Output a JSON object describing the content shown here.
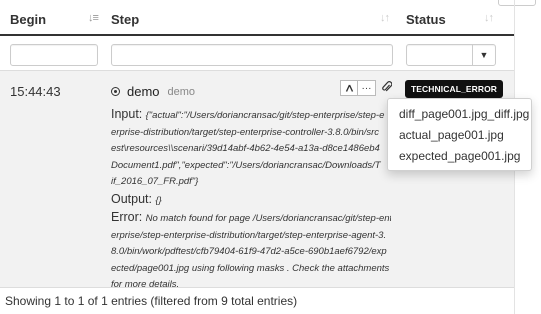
{
  "table": {
    "columns": [
      {
        "label": "Begin",
        "sort_icon": "sort-amount-down-icon"
      },
      {
        "label": "Step",
        "sort_icon": "sort-icon"
      },
      {
        "label": "Status",
        "sort_icon": "sort-icon"
      }
    ],
    "filters": {
      "begin_value": "",
      "step_value": "",
      "status_selected": ""
    },
    "rows": [
      {
        "begin": "15:44:43",
        "step_name": "demo",
        "step_sub": "demo",
        "status": "TECHNICAL_ERROR",
        "input_label": "Input:",
        "input_lines": [
          "{\"actual\":\"/Users/doriancransac/git/step-enterprise/step-e",
          "erprise-distribution/target/step-enterprise-controller-3.8.0/bin/src",
          "est\\resources\\\\scenari/39d14abf-4b62-4e54-a13a-d8ce1486eb4",
          "Document1.pdf\",\"expected\":\"/Users/doriancransac/Downloads/T",
          "if_2016_07_FR.pdf\"}"
        ],
        "output_label": "Output:",
        "output_value": "{}",
        "error_label": "Error:",
        "error_lines": [
          "No match found for page /Users/doriancransac/git/step-ent",
          "erprise/step-enterprise-distribution/target/step-enterprise-agent-3.",
          "8.0/bin/work/pdftest/cfb79404-61f9-47d2-a5ce-690b1aef6792/exp",
          "ected/page001.jpg using following masks . Check the attachments",
          "for more details."
        ]
      }
    ]
  },
  "attachments_menu": {
    "items": [
      "diff_page001.jpg_diff.jpg",
      "actual_page001.jpg",
      "expected_page001.jpg"
    ]
  },
  "footer": {
    "info": "Showing 1 to 1 of 1 entries (filtered from 9 total entries)"
  },
  "colors": {
    "status_badge_bg": "#111111",
    "row_bg": "#f2f2f2"
  }
}
